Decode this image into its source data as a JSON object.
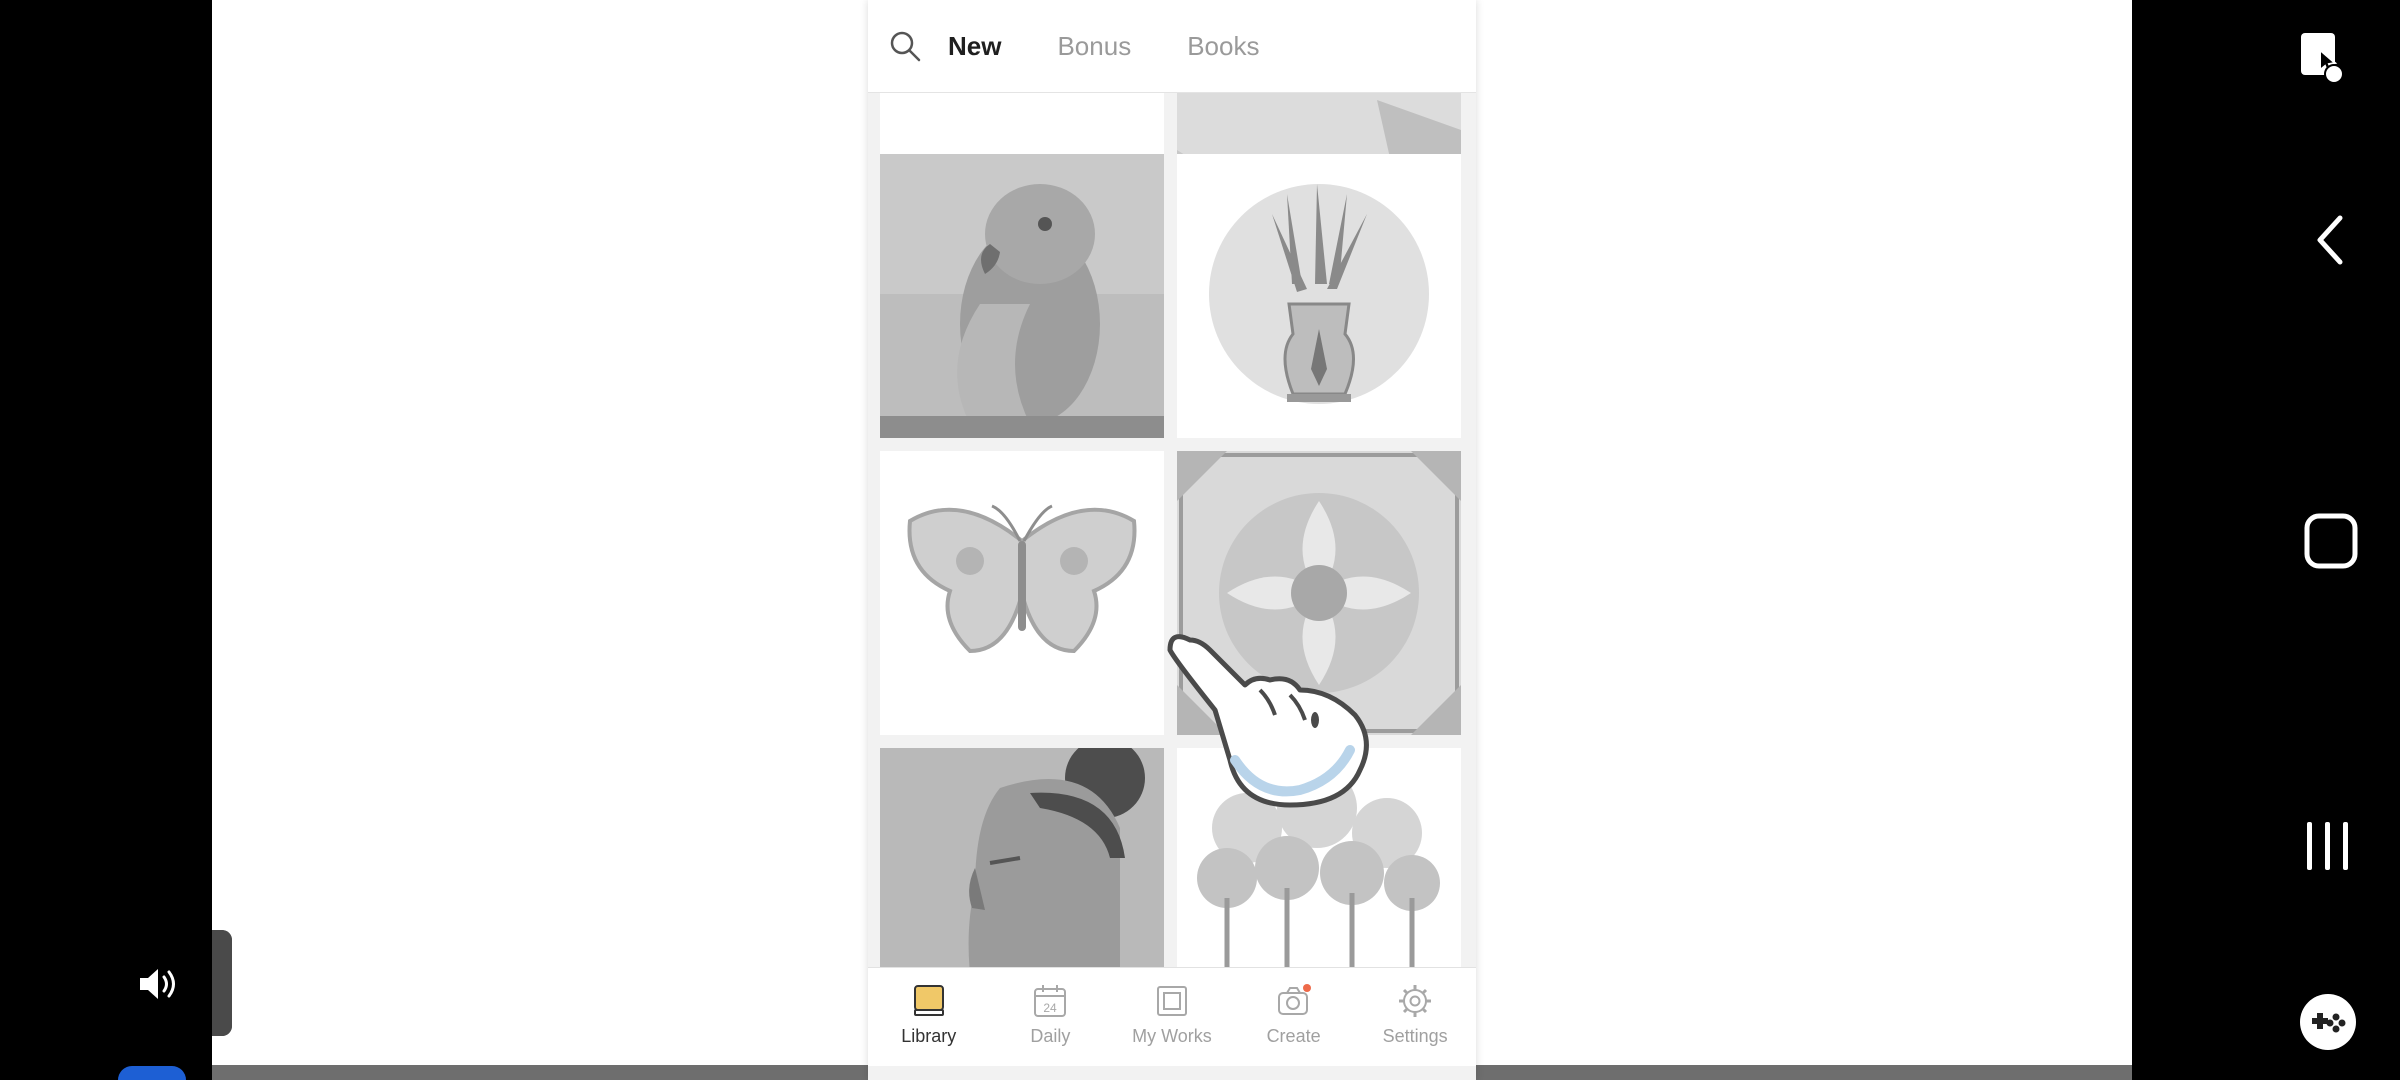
{
  "header": {
    "search_icon": "search-icon",
    "tabs": [
      {
        "label": "New",
        "active": true
      },
      {
        "label": "Bonus",
        "active": false
      },
      {
        "label": "Books",
        "active": false
      }
    ]
  },
  "grid": {
    "tiles": [
      {
        "subject": "parrot"
      },
      {
        "subject": "flowers-in-vase"
      },
      {
        "subject": "butterfly"
      },
      {
        "subject": "ornamental-tile"
      },
      {
        "subject": "woman-portrait"
      },
      {
        "subject": "trees"
      }
    ]
  },
  "bottom_nav": {
    "items": [
      {
        "label": "Library",
        "icon": "library-icon",
        "active": true
      },
      {
        "label": "Daily",
        "icon": "calendar-icon",
        "badge_text": "24"
      },
      {
        "label": "My Works",
        "icon": "frame-icon"
      },
      {
        "label": "Create",
        "icon": "camera-icon",
        "notification_dot": true
      },
      {
        "label": "Settings",
        "icon": "gear-icon"
      }
    ]
  },
  "system": {
    "buttons": [
      "screen-touch-icon",
      "back-icon",
      "home-icon",
      "recents-icon",
      "game-tools-icon"
    ],
    "volume_icon": "speaker-icon"
  },
  "colors": {
    "library_icon_fill": "#f0c868",
    "notification_dot": "#ee6a4a",
    "progress_blue": "#1d5fd4"
  }
}
